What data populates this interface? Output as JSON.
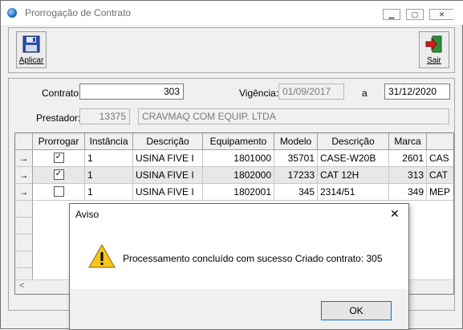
{
  "window": {
    "title": "Prorrogação de Contrato"
  },
  "toolbar": {
    "apply_label": "Aplicar",
    "exit_label": "Sair"
  },
  "form": {
    "contrato_label": "Contrato:",
    "contrato_value": "303",
    "vigencia_label": "Vigência:",
    "vigencia_start": "01/09/2017",
    "vigencia_sep": "a",
    "vigencia_end": "31/12/2020",
    "prestador_label": "Prestador:",
    "prestador_code": "13375",
    "prestador_name": "CRAVMAQ COM EQUIP. LTDA"
  },
  "grid": {
    "columns": [
      "Prorrogar",
      "Instância",
      "Descrição",
      "Equipamento",
      "Modelo",
      "Descrição",
      "Marca",
      ""
    ],
    "rows": [
      {
        "checked": true,
        "instancia": "1",
        "descricao": "USINA FIVE I",
        "equipamento": "1801000",
        "modelo": "35701",
        "descricao2": "CASE-W20B",
        "marca": "2601",
        "extra": "CAS"
      },
      {
        "checked": true,
        "instancia": "1",
        "descricao": "USINA FIVE I",
        "equipamento": "1802000",
        "modelo": "17233",
        "descricao2": "CAT 12H",
        "marca": "313",
        "extra": "CAT"
      },
      {
        "checked": false,
        "instancia": "1",
        "descricao": "USINA FIVE I",
        "equipamento": "1802001",
        "modelo": "345",
        "descricao2": "2314/51",
        "marca": "349",
        "extra": "MEP"
      }
    ]
  },
  "dialog": {
    "title": "Aviso",
    "message": "Processamento concluído com sucesso Criado contrato: 305",
    "ok_label": "OK",
    "close_glyph": "✕"
  },
  "icons": {
    "row_indicator": "→",
    "check": "✓",
    "scroll_left": "<"
  }
}
